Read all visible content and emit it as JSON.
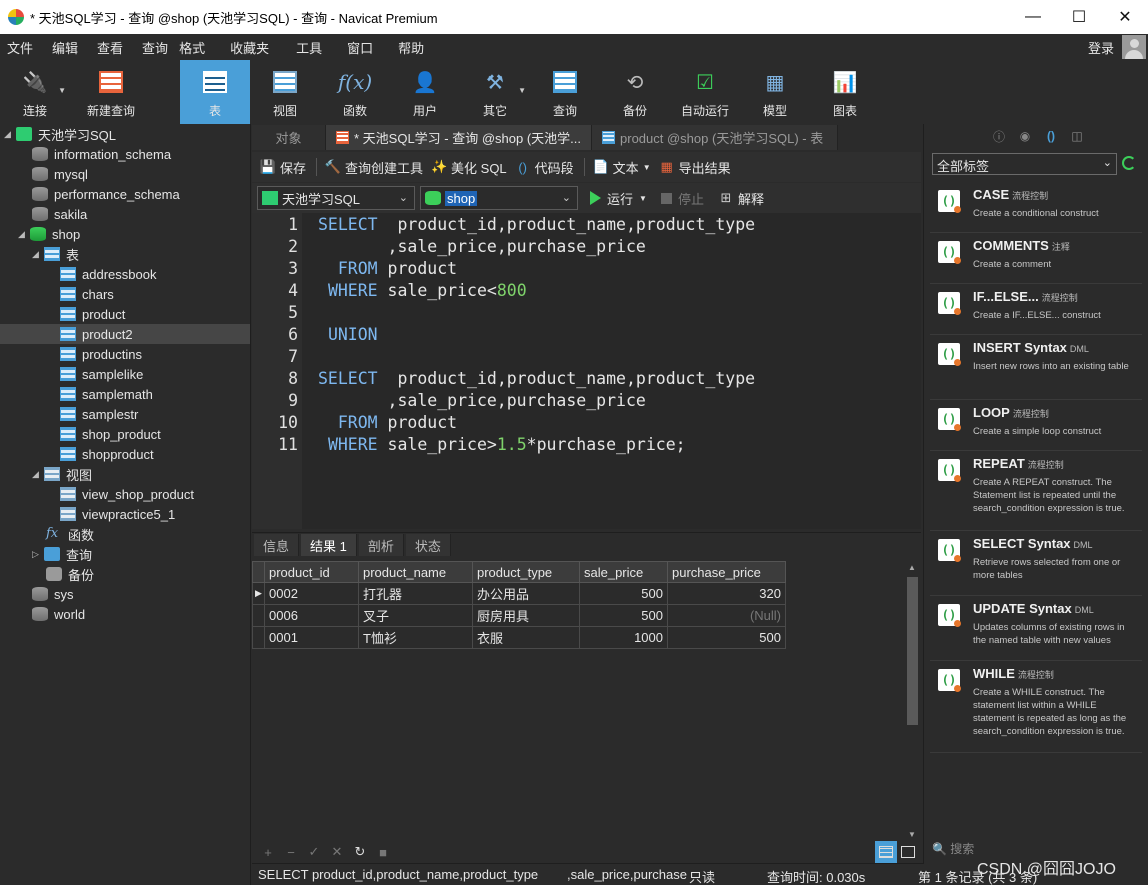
{
  "window": {
    "title": "* 天池SQL学习 - 查询 @shop (天池学习SQL) - 查询 - Navicat Premium",
    "minimize": "—",
    "maximize": "☐",
    "close": "✕"
  },
  "menu": {
    "items": [
      "文件",
      "编辑",
      "查看",
      "查询",
      "格式",
      "收藏夹",
      "工具",
      "窗口",
      "帮助"
    ],
    "login": "登录"
  },
  "toolbar": {
    "items": [
      {
        "label": "连接",
        "icon": "plug-icon"
      },
      {
        "label": "新建查询",
        "icon": "new-query-icon"
      },
      {
        "label": "表",
        "icon": "table-icon"
      },
      {
        "label": "视图",
        "icon": "view-icon"
      },
      {
        "label": "函数",
        "icon": "function-icon"
      },
      {
        "label": "用户",
        "icon": "user-icon"
      },
      {
        "label": "其它",
        "icon": "tools-icon"
      },
      {
        "label": "查询",
        "icon": "query-icon"
      },
      {
        "label": "备份",
        "icon": "backup-icon"
      },
      {
        "label": "自动运行",
        "icon": "automation-icon"
      },
      {
        "label": "模型",
        "icon": "model-icon"
      },
      {
        "label": "图表",
        "icon": "chart-icon"
      }
    ]
  },
  "navigator": {
    "connection": "天池学习SQL",
    "databases": [
      "information_schema",
      "mysql",
      "performance_schema",
      "sakila",
      "shop"
    ],
    "tables_label": "表",
    "tables": [
      "addressbook",
      "chars",
      "product",
      "product2",
      "productins",
      "samplelike",
      "samplemath",
      "samplestr",
      "shop_product",
      "shopproduct"
    ],
    "views_label": "视图",
    "views": [
      "view_shop_product",
      "viewpractice5_1"
    ],
    "functions_label": "函数",
    "queries_label": "查询",
    "backups_label": "备份",
    "other_dbs": [
      "sys",
      "world"
    ]
  },
  "tabs": {
    "objects": "对象",
    "query_tab": "* 天池SQL学习 - 查询 @shop (天池学...",
    "table_tab": "product @shop (天池学习SQL) - 表"
  },
  "query_toolbar": {
    "save": "保存",
    "builder": "查询创建工具",
    "beautify": "美化 SQL",
    "snippet": "代码段",
    "text": "文本",
    "export": "导出结果"
  },
  "selectors": {
    "connection": "天池学习SQL",
    "database": "shop",
    "run": "运行",
    "stop": "停止",
    "explain": "解释"
  },
  "editor": {
    "lines": [
      "1",
      "2",
      "3",
      "4",
      "5",
      "6",
      "7",
      "8",
      "9",
      "10",
      "11"
    ]
  },
  "result_tabs": [
    "信息",
    "结果 1",
    "剖析",
    "状态"
  ],
  "result": {
    "columns": [
      "product_id",
      "product_name",
      "product_type",
      "sale_price",
      "purchase_price"
    ],
    "rows": [
      [
        "0002",
        "打孔器",
        "办公用品",
        "500",
        "320"
      ],
      [
        "0006",
        "叉子",
        "厨房用具",
        "500",
        "(Null)"
      ],
      [
        "0001",
        "T恤衫",
        "衣服",
        "1000",
        "500"
      ]
    ]
  },
  "statusbar": {
    "sql": "SELECT  product_id,product_name,product_type",
    "sql2": ",sale_price,purchase",
    "mode": "只读",
    "time": "查询时间: 0.030s",
    "records": "第 1 条记录 (共 3 条)"
  },
  "watermark": "CSDN @囧囧JOJO",
  "right_panel": {
    "tag_select": "全部标签",
    "search_placeholder": "搜索",
    "snippets": [
      {
        "title": "CASE",
        "tag": "流程控制",
        "desc": "Create a conditional construct"
      },
      {
        "title": "COMMENTS",
        "tag": "注释",
        "desc": "Create a comment"
      },
      {
        "title": "IF...ELSE...",
        "tag": "流程控制",
        "desc": "Create a IF...ELSE... construct"
      },
      {
        "title": "INSERT Syntax",
        "tag": "DML",
        "desc": "Insert new rows into an existing table"
      },
      {
        "title": "LOOP",
        "tag": "流程控制",
        "desc": "Create a simple loop construct"
      },
      {
        "title": "REPEAT",
        "tag": "流程控制",
        "desc": "Create A REPEAT construct. The Statement list is repeated until the search_condition expression is true."
      },
      {
        "title": "SELECT Syntax",
        "tag": "DML",
        "desc": "Retrieve rows selected from one or more tables"
      },
      {
        "title": "UPDATE Syntax",
        "tag": "DML",
        "desc": "Updates columns of existing rows in the named table with new values"
      },
      {
        "title": "WHILE",
        "tag": "流程控制",
        "desc": "Create a WHILE construct. The statement list within a WHILE statement is repeated as long as the search_condition expression is true."
      }
    ]
  }
}
